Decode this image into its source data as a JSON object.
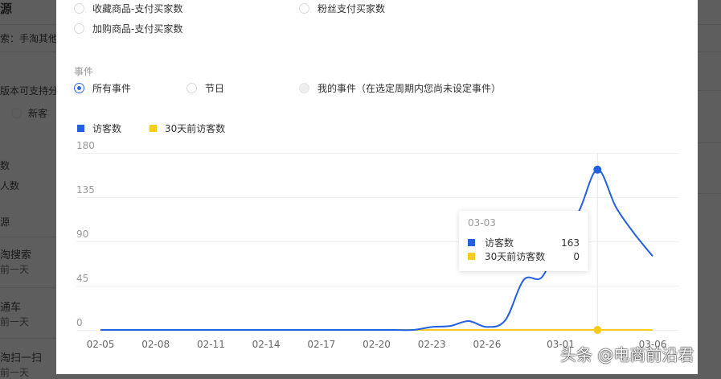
{
  "background": {
    "left": [
      "源",
      "索：手淘其他",
      "版本可支持分",
      "新客",
      "数",
      "人数",
      "源",
      "淘搜索",
      "前一天",
      "通车",
      "前一天",
      "淘扫一扫",
      "前一天"
    ]
  },
  "modal": {
    "metric_options": [
      {
        "label": "收藏商品-支付买家数",
        "selected": false
      },
      {
        "label": "粉丝支付买家数",
        "selected": false
      },
      {
        "label": "加购商品-支付买家数",
        "selected": false
      }
    ],
    "events_label": "事件",
    "event_options": [
      {
        "label": "所有事件",
        "selected": true
      },
      {
        "label": "节日",
        "selected": false
      },
      {
        "label": "我的事件（在选定周期内您尚未设定事件）",
        "selected": false,
        "disabled": true
      }
    ]
  },
  "chart_data": {
    "type": "line",
    "x": [
      "02-05",
      "02-06",
      "02-07",
      "02-08",
      "02-09",
      "02-10",
      "02-11",
      "02-12",
      "02-13",
      "02-14",
      "02-15",
      "02-16",
      "02-17",
      "02-18",
      "02-19",
      "02-20",
      "02-21",
      "02-22",
      "02-23",
      "02-24",
      "02-25",
      "02-26",
      "02-27",
      "02-28",
      "02-29",
      "03-01",
      "03-02",
      "03-03",
      "03-04",
      "03-05",
      "03-06"
    ],
    "xticks": [
      "02-05",
      "02-08",
      "02-11",
      "02-14",
      "02-17",
      "02-20",
      "02-23",
      "02-26",
      "03-01",
      "03-06"
    ],
    "yticks": [
      "180",
      "135",
      "90",
      "45",
      "0"
    ],
    "ylim": [
      0,
      180
    ],
    "grid": true,
    "legend_position": "top-left",
    "series": [
      {
        "name": "访客数",
        "color": "#2360e0",
        "values": [
          0,
          0,
          0,
          0,
          0,
          0,
          0,
          0,
          0,
          0,
          0,
          0,
          0,
          0,
          0,
          0,
          0,
          0,
          3,
          4,
          9,
          3,
          10,
          51,
          54,
          95,
          121,
          163,
          125,
          98,
          75
        ]
      },
      {
        "name": "30天前访客数",
        "color": "#f5cc1f",
        "values": [
          0,
          0,
          0,
          0,
          0,
          0,
          0,
          0,
          0,
          0,
          0,
          0,
          0,
          0,
          0,
          0,
          0,
          0,
          0,
          0,
          0,
          0,
          0,
          0,
          0,
          0,
          0,
          0,
          0,
          0,
          0
        ]
      }
    ],
    "tooltip": {
      "date": "03-03",
      "rows": [
        {
          "name": "访客数",
          "value": "163"
        },
        {
          "name": "30天前访客数",
          "value": "0"
        }
      ]
    }
  },
  "watermark": "头条 @电商前沿君"
}
